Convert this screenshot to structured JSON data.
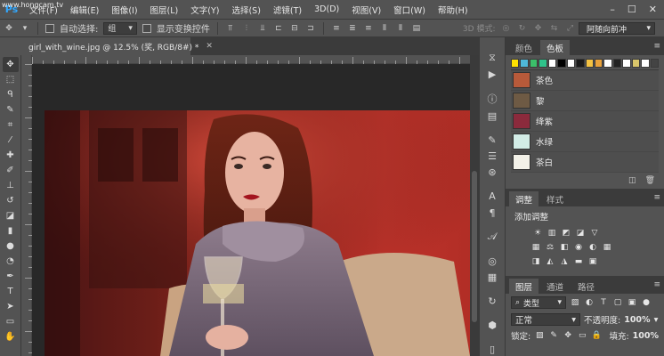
{
  "app": {
    "watermark": "www.hongcam.tv"
  },
  "menubar": {
    "items": [
      "文件(F)",
      "编辑(E)",
      "图像(I)",
      "图层(L)",
      "文字(Y)",
      "选择(S)",
      "滤镜(T)",
      "3D(D)",
      "视图(V)",
      "窗口(W)",
      "帮助(H)"
    ]
  },
  "options": {
    "auto_select_label": "自动选择:",
    "auto_select_value": "组",
    "show_transform_label": "显示变换控件",
    "mode_3d_label": "3D 模式:",
    "workspace_value": "阿随向前冲"
  },
  "document": {
    "tab_title": "girl_with_wine.jpg @ 12.5% (奖, RGB/8#) *"
  },
  "swatches_panel": {
    "tabs": [
      "颜色",
      "色板"
    ],
    "active_tab": "色板",
    "strip_colors": [
      "#ffe200",
      "#4fb8d8",
      "#3bbf6a",
      "#2fc28a",
      "#ffffff",
      "#000000",
      "#ffffff",
      "#1a1a1a",
      "#f4c242",
      "#e9a23b",
      "#ffffff",
      "#222222",
      "#ffffff",
      "#d9c66b",
      "#ffffff",
      "#444444"
    ],
    "items": [
      {
        "label": "茶色",
        "color": "#b85a3a"
      },
      {
        "label": "黎",
        "color": "#6e5a44"
      },
      {
        "label": "绛紫",
        "color": "#8b2a3c"
      },
      {
        "label": "水绿",
        "color": "#d2ece6"
      },
      {
        "label": "茶白",
        "color": "#f3f1e8"
      }
    ]
  },
  "adjustments_panel": {
    "tabs": [
      "调整",
      "样式"
    ],
    "active_tab": "调整",
    "title": "添加调整"
  },
  "layers_panel": {
    "tabs": [
      "图层",
      "通道",
      "路径"
    ],
    "active_tab": "图层",
    "filter_label": "类型",
    "blend_mode": "正常",
    "opacity_label": "不透明度:",
    "opacity_value": "100%",
    "lock_label": "锁定:",
    "fill_label": "填充:",
    "fill_value": "100%"
  }
}
